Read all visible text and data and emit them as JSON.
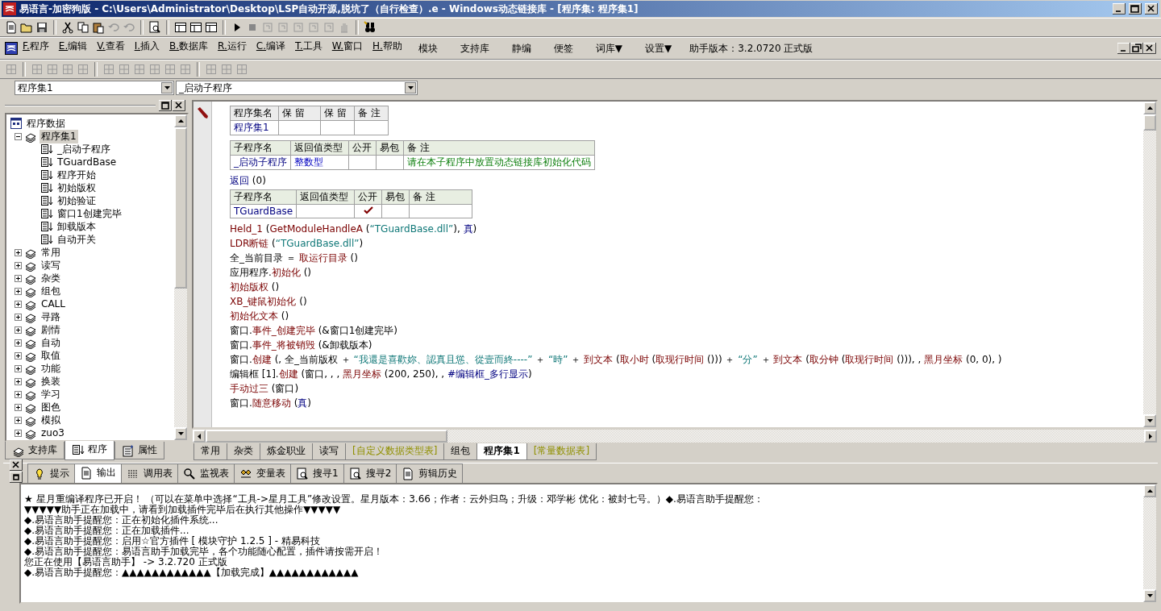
{
  "window": {
    "title": "易语言-加密狗版 - C:\\Users\\Administrator\\Desktop\\LSP自动开源,脱坑了（自行检查）.e - Windows动态链接库 - [程序集: 程序集1]"
  },
  "menu": [
    {
      "label": "F.程序",
      "kind": "menu"
    },
    {
      "label": "E.编辑",
      "kind": "menu"
    },
    {
      "label": "V.查看",
      "kind": "menu"
    },
    {
      "label": "I.插入",
      "kind": "menu"
    },
    {
      "label": "B.数据库",
      "kind": "menu"
    },
    {
      "label": "R.运行",
      "kind": "menu"
    },
    {
      "label": "C.编译",
      "kind": "menu"
    },
    {
      "label": "T.工具",
      "kind": "menu"
    },
    {
      "label": "W.窗口",
      "kind": "menu"
    },
    {
      "label": "H.帮助",
      "kind": "menu"
    },
    {
      "label": "模块",
      "kind": "command"
    },
    {
      "label": "支持库",
      "kind": "command"
    },
    {
      "label": "静编",
      "kind": "command"
    },
    {
      "label": "便签",
      "kind": "command"
    },
    {
      "label": "词库▼",
      "kind": "command"
    },
    {
      "label": "设置▼",
      "kind": "command"
    },
    {
      "label": "助手版本：3.2.0720 正式版",
      "kind": "info"
    }
  ],
  "selectors": [
    {
      "value": "程序集1"
    },
    {
      "value": "_启动子程序"
    }
  ],
  "tree": {
    "label": "程序数据",
    "children": [
      {
        "label": "程序集1",
        "expanded": true,
        "selected": true,
        "children": [
          {
            "label": "_启动子程序",
            "selected": false
          },
          {
            "label": "TGuardBase",
            "selected": false
          },
          {
            "label": "程序开始",
            "selected": false
          },
          {
            "label": "初始版权",
            "selected": false
          },
          {
            "label": "初始验证",
            "selected": false
          },
          {
            "label": "窗口1创建完毕",
            "selected": false
          },
          {
            "label": "卸载版本",
            "selected": false
          },
          {
            "label": "自动开关",
            "selected": false
          }
        ]
      },
      {
        "label": "常用",
        "expanded": false,
        "selected": false
      },
      {
        "label": "读写",
        "expanded": false,
        "selected": false
      },
      {
        "label": "杂类",
        "expanded": false,
        "selected": false
      },
      {
        "label": "组包",
        "expanded": false,
        "selected": false
      },
      {
        "label": "CALL",
        "expanded": false,
        "selected": false
      },
      {
        "label": "寻路",
        "expanded": false,
        "selected": false
      },
      {
        "label": "剧情",
        "expanded": false,
        "selected": false
      },
      {
        "label": "自动",
        "expanded": false,
        "selected": false
      },
      {
        "label": "取值",
        "expanded": false,
        "selected": false
      },
      {
        "label": "功能",
        "expanded": false,
        "selected": false
      },
      {
        "label": "换装",
        "expanded": false,
        "selected": false
      },
      {
        "label": "学习",
        "expanded": false,
        "selected": false
      },
      {
        "label": "图色",
        "expanded": false,
        "selected": false
      },
      {
        "label": "模拟",
        "expanded": false,
        "selected": false
      },
      {
        "label": "zuo3",
        "expanded": false,
        "selected": false
      }
    ]
  },
  "left_tabs": [
    {
      "label": "支持库",
      "selected": false
    },
    {
      "label": "程序",
      "selected": true
    },
    {
      "label": "属性",
      "selected": false
    }
  ],
  "code": {
    "blocks": [
      {
        "kind": "module_table",
        "headers": [
          "程序集名",
          "保 留",
          "保 留",
          "备 注"
        ],
        "rows": [
          {
            "name": "程序集1"
          }
        ]
      },
      {
        "kind": "sub_table",
        "headers": [
          "子程序名",
          "返回值类型",
          "公开",
          "易包",
          "备 注"
        ],
        "rows": [
          {
            "name": "_启动子程序",
            "return_type": "整数型",
            "public": false,
            "packaged": false,
            "note": "请在本子程序中放置动态链接库初始化代码"
          }
        ]
      },
      {
        "kind": "line",
        "segments": [
          {
            "kind": "kw",
            "text": "返回"
          },
          {
            "kind": "plain",
            "text": " (0)"
          }
        ]
      },
      {
        "kind": "sub_table",
        "headers": [
          "子程序名",
          "返回值类型",
          "公开",
          "易包",
          "备 注"
        ],
        "rows": [
          {
            "name": "TGuardBase",
            "public": true,
            "packaged": false
          }
        ]
      },
      {
        "kind": "line",
        "segments": [
          {
            "kind": "fn",
            "text": "Held_1"
          },
          {
            "kind": "plain",
            "text": " ("
          },
          {
            "kind": "fn",
            "text": "GetModuleHandleA"
          },
          {
            "kind": "plain",
            "text": " ("
          },
          {
            "kind": "str",
            "text": "“TGuardBase.dll”"
          },
          {
            "kind": "plain",
            "text": "), "
          },
          {
            "kind": "kw",
            "text": "真"
          },
          {
            "kind": "plain",
            "text": ")"
          }
        ]
      },
      {
        "kind": "line",
        "segments": [
          {
            "kind": "fn",
            "text": "LDR断链"
          },
          {
            "kind": "plain",
            "text": " ("
          },
          {
            "kind": "str",
            "text": "“TGuardBase.dll”"
          },
          {
            "kind": "plain",
            "text": ")"
          }
        ]
      },
      {
        "kind": "line",
        "segments": [
          {
            "kind": "plain",
            "text": "全_当前目录 ＝ "
          },
          {
            "kind": "fn",
            "text": "取运行目录"
          },
          {
            "kind": "plain",
            "text": " ()"
          }
        ]
      },
      {
        "kind": "line",
        "segments": [
          {
            "kind": "plain",
            "text": "应用程序."
          },
          {
            "kind": "fn",
            "text": "初始化"
          },
          {
            "kind": "plain",
            "text": " ()"
          }
        ]
      },
      {
        "kind": "line",
        "segments": [
          {
            "kind": "fn",
            "text": "初始版权"
          },
          {
            "kind": "plain",
            "text": " ()"
          }
        ]
      },
      {
        "kind": "line",
        "segments": [
          {
            "kind": "fn",
            "text": "XB_键鼠初始化"
          },
          {
            "kind": "plain",
            "text": " ()"
          }
        ]
      },
      {
        "kind": "line",
        "segments": [
          {
            "kind": "fn",
            "text": "初始化文本"
          },
          {
            "kind": "plain",
            "text": " ()"
          }
        ]
      },
      {
        "kind": "line",
        "segments": [
          {
            "kind": "plain",
            "text": "窗口."
          },
          {
            "kind": "fn",
            "text": "事件_创建完毕"
          },
          {
            "kind": "plain",
            "text": " (&窗口1创建完毕)"
          }
        ]
      },
      {
        "kind": "line",
        "segments": [
          {
            "kind": "plain",
            "text": "窗口."
          },
          {
            "kind": "fn",
            "text": "事件_将被销毁"
          },
          {
            "kind": "plain",
            "text": " (&卸载版本)"
          }
        ]
      },
      {
        "kind": "line",
        "segments": [
          {
            "kind": "plain",
            "text": "窗口."
          },
          {
            "kind": "fn",
            "text": "创建"
          },
          {
            "kind": "plain",
            "text": " (, 全_当前版权 ＋ "
          },
          {
            "kind": "str",
            "text": "“我還是喜歡妳、認真且慫、從壹而終----”"
          },
          {
            "kind": "plain",
            "text": " ＋ "
          },
          {
            "kind": "str",
            "text": "“時”"
          },
          {
            "kind": "plain",
            "text": " ＋ "
          },
          {
            "kind": "fn",
            "text": "到文本"
          },
          {
            "kind": "plain",
            "text": " ("
          },
          {
            "kind": "fn",
            "text": "取小时"
          },
          {
            "kind": "plain",
            "text": " ("
          },
          {
            "kind": "fn",
            "text": "取现行时间"
          },
          {
            "kind": "plain",
            "text": " ())) ＋ "
          },
          {
            "kind": "str",
            "text": "“分”"
          },
          {
            "kind": "plain",
            "text": " ＋ "
          },
          {
            "kind": "fn",
            "text": "到文本"
          },
          {
            "kind": "plain",
            "text": " ("
          },
          {
            "kind": "fn",
            "text": "取分钟"
          },
          {
            "kind": "plain",
            "text": " ("
          },
          {
            "kind": "fn",
            "text": "取现行时间"
          },
          {
            "kind": "plain",
            "text": " ())), , "
          },
          {
            "kind": "fn",
            "text": "黑月坐标"
          },
          {
            "kind": "plain",
            "text": " (0, 0), )"
          }
        ]
      },
      {
        "kind": "line",
        "segments": [
          {
            "kind": "plain",
            "text": "编辑框 [1]."
          },
          {
            "kind": "fn",
            "text": "创建"
          },
          {
            "kind": "plain",
            "text": " (窗口, , , "
          },
          {
            "kind": "fn",
            "text": "黑月坐标"
          },
          {
            "kind": "plain",
            "text": " (200, 250), , "
          },
          {
            "kind": "const",
            "text": "#编辑框_多行显示"
          },
          {
            "kind": "plain",
            "text": ")"
          }
        ]
      },
      {
        "kind": "line",
        "segments": [
          {
            "kind": "fn",
            "text": "手动过三"
          },
          {
            "kind": "plain",
            "text": " (窗口)"
          }
        ]
      },
      {
        "kind": "line",
        "segments": [
          {
            "kind": "plain",
            "text": "窗口."
          },
          {
            "kind": "fn",
            "text": "随意移动"
          },
          {
            "kind": "plain",
            "text": " ("
          },
          {
            "kind": "kw",
            "text": "真"
          },
          {
            "kind": "plain",
            "text": ")"
          }
        ]
      }
    ]
  },
  "code_tabs": [
    {
      "label": "常用",
      "kind": "module",
      "selected": false
    },
    {
      "label": "杂类",
      "kind": "module",
      "selected": false
    },
    {
      "label": "炼金职业",
      "kind": "module",
      "selected": false
    },
    {
      "label": "读写",
      "kind": "module",
      "selected": false
    },
    {
      "label": "[自定义数据类型表]",
      "kind": "table",
      "selected": false
    },
    {
      "label": "组包",
      "kind": "module",
      "selected": false
    },
    {
      "label": "程序集1",
      "kind": "module",
      "selected": true
    },
    {
      "label": "[常量数据表]",
      "kind": "table",
      "selected": false
    }
  ],
  "output_tabs": [
    {
      "label": "提示",
      "selected": false
    },
    {
      "label": "输出",
      "selected": true
    },
    {
      "label": "调用表",
      "selected": false
    },
    {
      "label": "监视表",
      "selected": false
    },
    {
      "label": "变量表",
      "selected": false
    },
    {
      "label": "搜寻1",
      "selected": false
    },
    {
      "label": "搜寻2",
      "selected": false
    },
    {
      "label": "剪辑历史",
      "selected": false
    }
  ],
  "output_lines": [
    "★ 星月重编译程序已开启！ （可以在菜单中选择“工具->星月工具”修改设置。星月版本：3.66；作者：云外归鸟；升级：邓学彬 优化：被封七号。）◆.易语言助手提醒您：",
    "▼▼▼▼▼助手正在加载中，请看到加载插件完毕后在执行其他操作▼▼▼▼▼",
    "◆.易语言助手提醒您：正在初始化插件系统...",
    "◆.易语言助手提醒您：正在加载插件...",
    "◆.易语言助手提醒您：启用☆官方插件 [ 模块守护 1.2.5 ] - 精易科技",
    "◆.易语言助手提醒您：易语言助手加载完毕，各个功能随心配置，插件请按需开启！",
    "您正在使用【易语言助手】 -> 3.2.720 正式版",
    "◆.易语言助手提醒您：▲▲▲▲▲▲▲▲▲▲▲▲【加载完成】▲▲▲▲▲▲▲▲▲▲▲▲"
  ]
}
